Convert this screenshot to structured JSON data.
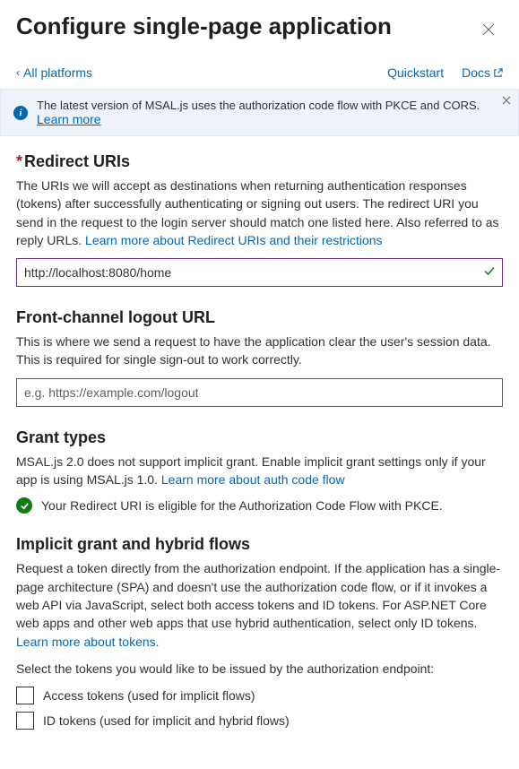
{
  "header": {
    "title": "Configure single-page application"
  },
  "topbar": {
    "back": "All platforms",
    "quickstart": "Quickstart",
    "docs": "Docs"
  },
  "banner": {
    "text": "The latest version of MSAL.js uses the authorization code flow with PKCE and CORS.",
    "learn": "Learn more"
  },
  "redirect": {
    "title": "Redirect URIs",
    "desc": "The URIs we will accept as destinations when returning authentication responses (tokens) after successfully authenticating or signing out users. The redirect URI you send in the request to the login server should match one listed here. Also referred to as reply URLs. ",
    "link": "Learn more about Redirect URIs and their restrictions",
    "value": "http://localhost:8080/home"
  },
  "logout": {
    "title": "Front-channel logout URL",
    "desc": "This is where we send a request to have the application clear the user's session data. This is required for single sign-out to work correctly.",
    "placeholder": "e.g. https://example.com/logout"
  },
  "grant": {
    "title": "Grant types",
    "desc": "MSAL.js 2.0 does not support implicit grant. Enable implicit grant settings only if your app is using MSAL.js 1.0. ",
    "link": "Learn more about auth code flow",
    "success": "Your Redirect URI is eligible for the Authorization Code Flow with PKCE."
  },
  "implicit": {
    "title": "Implicit grant and hybrid flows",
    "desc": "Request a token directly from the authorization endpoint. If the application has a single-page architecture (SPA) and doesn't use the authorization code flow, or if it invokes a web API via JavaScript, select both access tokens and ID tokens. For ASP.NET Core web apps and other web apps that use hybrid authentication, select only ID tokens. ",
    "link": "Learn more about tokens.",
    "select_label": "Select the tokens you would like to be issued by the authorization endpoint:",
    "access": "Access tokens (used for implicit flows)",
    "id": "ID tokens (used for implicit and hybrid flows)"
  }
}
